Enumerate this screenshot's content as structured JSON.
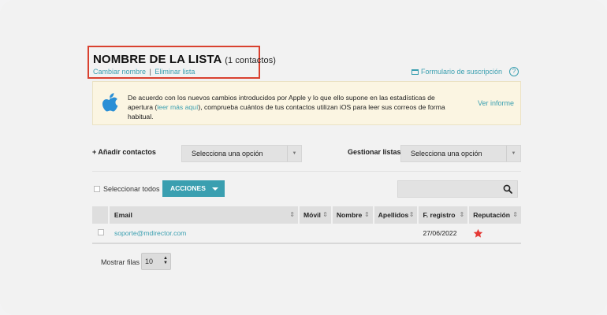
{
  "list": {
    "title": "NOMBRE DE LA LISTA",
    "count": "(1 contactos)",
    "rename_label": "Cambiar nombre",
    "separator": "|",
    "delete_label": "Eliminar lista",
    "subscription_form_label": "Formulario de suscripción",
    "help_glyph": "?"
  },
  "notice": {
    "text_before": "De acuerdo con los nuevos cambios introducidos por Apple y lo que ello supone en las estadísticas de apertura (",
    "link_text": "leer más aquí",
    "text_after": "), comprueba cuántos de tus contactos utilizan iOS para leer sus correos de forma habitual.",
    "more_label": "Ver informe",
    "icon": "apple-icon"
  },
  "toolbar": {
    "add_contacts_label": "+ Añadir contactos",
    "add_select_value": "Selecciona una opción",
    "manage_lists_label": "Gestionar listas",
    "manage_select_value": "Selecciona una opción",
    "select_all_label": "Seleccionar todos",
    "actions_label": "ACCIONES",
    "search_placeholder": ""
  },
  "table": {
    "columns": [
      "Email",
      "Móvil",
      "Nombre",
      "Apellidos",
      "F. registro",
      "Reputación"
    ],
    "rows": [
      {
        "email": "soporte@mdirector.com",
        "movil": "",
        "nombre": "",
        "apellidos": "",
        "registro": "27/06/2022",
        "reputacion": "star-icon"
      }
    ]
  },
  "pagination": {
    "rows_label": "Mostrar filas",
    "rows_value": "10"
  },
  "colors": {
    "accent": "#3a9fb0",
    "highlight_border": "#d9412f",
    "star": "#e53935",
    "notice_bg": "#fbf5e2"
  }
}
